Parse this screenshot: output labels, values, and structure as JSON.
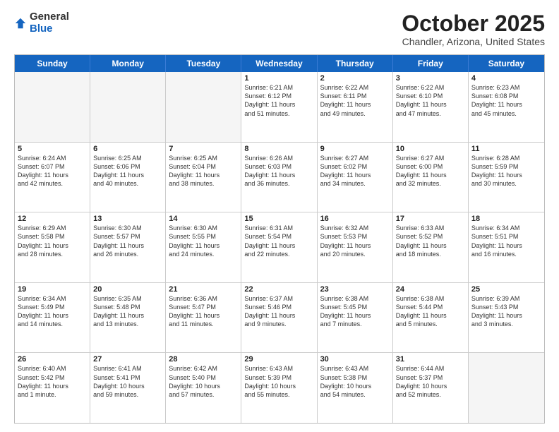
{
  "logo": {
    "general": "General",
    "blue": "Blue"
  },
  "title": "October 2025",
  "location": "Chandler, Arizona, United States",
  "header_days": [
    "Sunday",
    "Monday",
    "Tuesday",
    "Wednesday",
    "Thursday",
    "Friday",
    "Saturday"
  ],
  "rows": [
    [
      {
        "day": "",
        "text": "",
        "empty": true
      },
      {
        "day": "",
        "text": "",
        "empty": true
      },
      {
        "day": "",
        "text": "",
        "empty": true
      },
      {
        "day": "1",
        "text": "Sunrise: 6:21 AM\nSunset: 6:12 PM\nDaylight: 11 hours\nand 51 minutes."
      },
      {
        "day": "2",
        "text": "Sunrise: 6:22 AM\nSunset: 6:11 PM\nDaylight: 11 hours\nand 49 minutes."
      },
      {
        "day": "3",
        "text": "Sunrise: 6:22 AM\nSunset: 6:10 PM\nDaylight: 11 hours\nand 47 minutes."
      },
      {
        "day": "4",
        "text": "Sunrise: 6:23 AM\nSunset: 6:08 PM\nDaylight: 11 hours\nand 45 minutes."
      }
    ],
    [
      {
        "day": "5",
        "text": "Sunrise: 6:24 AM\nSunset: 6:07 PM\nDaylight: 11 hours\nand 42 minutes."
      },
      {
        "day": "6",
        "text": "Sunrise: 6:25 AM\nSunset: 6:06 PM\nDaylight: 11 hours\nand 40 minutes."
      },
      {
        "day": "7",
        "text": "Sunrise: 6:25 AM\nSunset: 6:04 PM\nDaylight: 11 hours\nand 38 minutes."
      },
      {
        "day": "8",
        "text": "Sunrise: 6:26 AM\nSunset: 6:03 PM\nDaylight: 11 hours\nand 36 minutes."
      },
      {
        "day": "9",
        "text": "Sunrise: 6:27 AM\nSunset: 6:02 PM\nDaylight: 11 hours\nand 34 minutes."
      },
      {
        "day": "10",
        "text": "Sunrise: 6:27 AM\nSunset: 6:00 PM\nDaylight: 11 hours\nand 32 minutes."
      },
      {
        "day": "11",
        "text": "Sunrise: 6:28 AM\nSunset: 5:59 PM\nDaylight: 11 hours\nand 30 minutes."
      }
    ],
    [
      {
        "day": "12",
        "text": "Sunrise: 6:29 AM\nSunset: 5:58 PM\nDaylight: 11 hours\nand 28 minutes."
      },
      {
        "day": "13",
        "text": "Sunrise: 6:30 AM\nSunset: 5:57 PM\nDaylight: 11 hours\nand 26 minutes."
      },
      {
        "day": "14",
        "text": "Sunrise: 6:30 AM\nSunset: 5:55 PM\nDaylight: 11 hours\nand 24 minutes."
      },
      {
        "day": "15",
        "text": "Sunrise: 6:31 AM\nSunset: 5:54 PM\nDaylight: 11 hours\nand 22 minutes."
      },
      {
        "day": "16",
        "text": "Sunrise: 6:32 AM\nSunset: 5:53 PM\nDaylight: 11 hours\nand 20 minutes."
      },
      {
        "day": "17",
        "text": "Sunrise: 6:33 AM\nSunset: 5:52 PM\nDaylight: 11 hours\nand 18 minutes."
      },
      {
        "day": "18",
        "text": "Sunrise: 6:34 AM\nSunset: 5:51 PM\nDaylight: 11 hours\nand 16 minutes."
      }
    ],
    [
      {
        "day": "19",
        "text": "Sunrise: 6:34 AM\nSunset: 5:49 PM\nDaylight: 11 hours\nand 14 minutes."
      },
      {
        "day": "20",
        "text": "Sunrise: 6:35 AM\nSunset: 5:48 PM\nDaylight: 11 hours\nand 13 minutes."
      },
      {
        "day": "21",
        "text": "Sunrise: 6:36 AM\nSunset: 5:47 PM\nDaylight: 11 hours\nand 11 minutes."
      },
      {
        "day": "22",
        "text": "Sunrise: 6:37 AM\nSunset: 5:46 PM\nDaylight: 11 hours\nand 9 minutes."
      },
      {
        "day": "23",
        "text": "Sunrise: 6:38 AM\nSunset: 5:45 PM\nDaylight: 11 hours\nand 7 minutes."
      },
      {
        "day": "24",
        "text": "Sunrise: 6:38 AM\nSunset: 5:44 PM\nDaylight: 11 hours\nand 5 minutes."
      },
      {
        "day": "25",
        "text": "Sunrise: 6:39 AM\nSunset: 5:43 PM\nDaylight: 11 hours\nand 3 minutes."
      }
    ],
    [
      {
        "day": "26",
        "text": "Sunrise: 6:40 AM\nSunset: 5:42 PM\nDaylight: 11 hours\nand 1 minute."
      },
      {
        "day": "27",
        "text": "Sunrise: 6:41 AM\nSunset: 5:41 PM\nDaylight: 10 hours\nand 59 minutes."
      },
      {
        "day": "28",
        "text": "Sunrise: 6:42 AM\nSunset: 5:40 PM\nDaylight: 10 hours\nand 57 minutes."
      },
      {
        "day": "29",
        "text": "Sunrise: 6:43 AM\nSunset: 5:39 PM\nDaylight: 10 hours\nand 55 minutes."
      },
      {
        "day": "30",
        "text": "Sunrise: 6:43 AM\nSunset: 5:38 PM\nDaylight: 10 hours\nand 54 minutes."
      },
      {
        "day": "31",
        "text": "Sunrise: 6:44 AM\nSunset: 5:37 PM\nDaylight: 10 hours\nand 52 minutes."
      },
      {
        "day": "",
        "text": "",
        "empty": true
      }
    ]
  ]
}
